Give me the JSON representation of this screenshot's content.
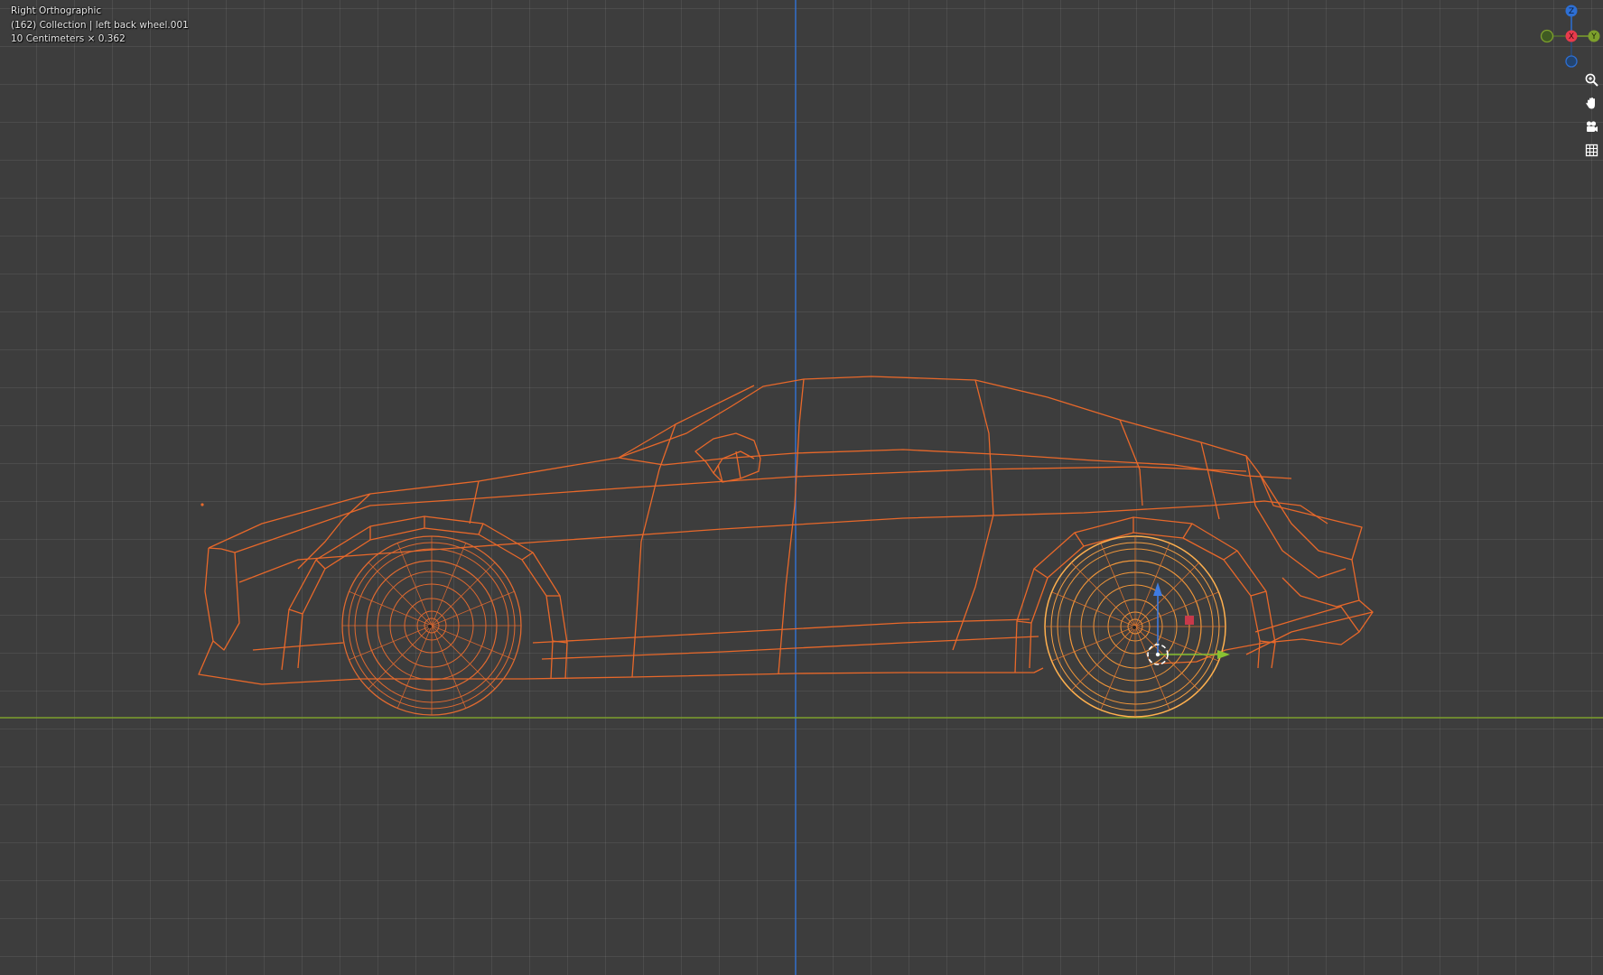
{
  "viewport": {
    "view_name": "Right Orthographic",
    "collection_info": "(162) Collection | left back wheel.001",
    "scale_info": "10 Centimeters × 0.362"
  },
  "gizmo": {
    "z_label": "Z",
    "x_label": "X",
    "y_label": "Y"
  },
  "nav_tools": [
    {
      "name": "zoom-icon"
    },
    {
      "name": "hand-pan-icon"
    },
    {
      "name": "camera-view-icon"
    },
    {
      "name": "ortho-grid-icon"
    }
  ],
  "colors": {
    "background": "#3d3d3d",
    "grid": "#505050",
    "wire_selected": "#e86a2c",
    "wire_active": "#ffaa4a",
    "axis_z": "#2d6fd4",
    "axis_y": "#7da02c",
    "axis_x": "#e83a4c"
  }
}
